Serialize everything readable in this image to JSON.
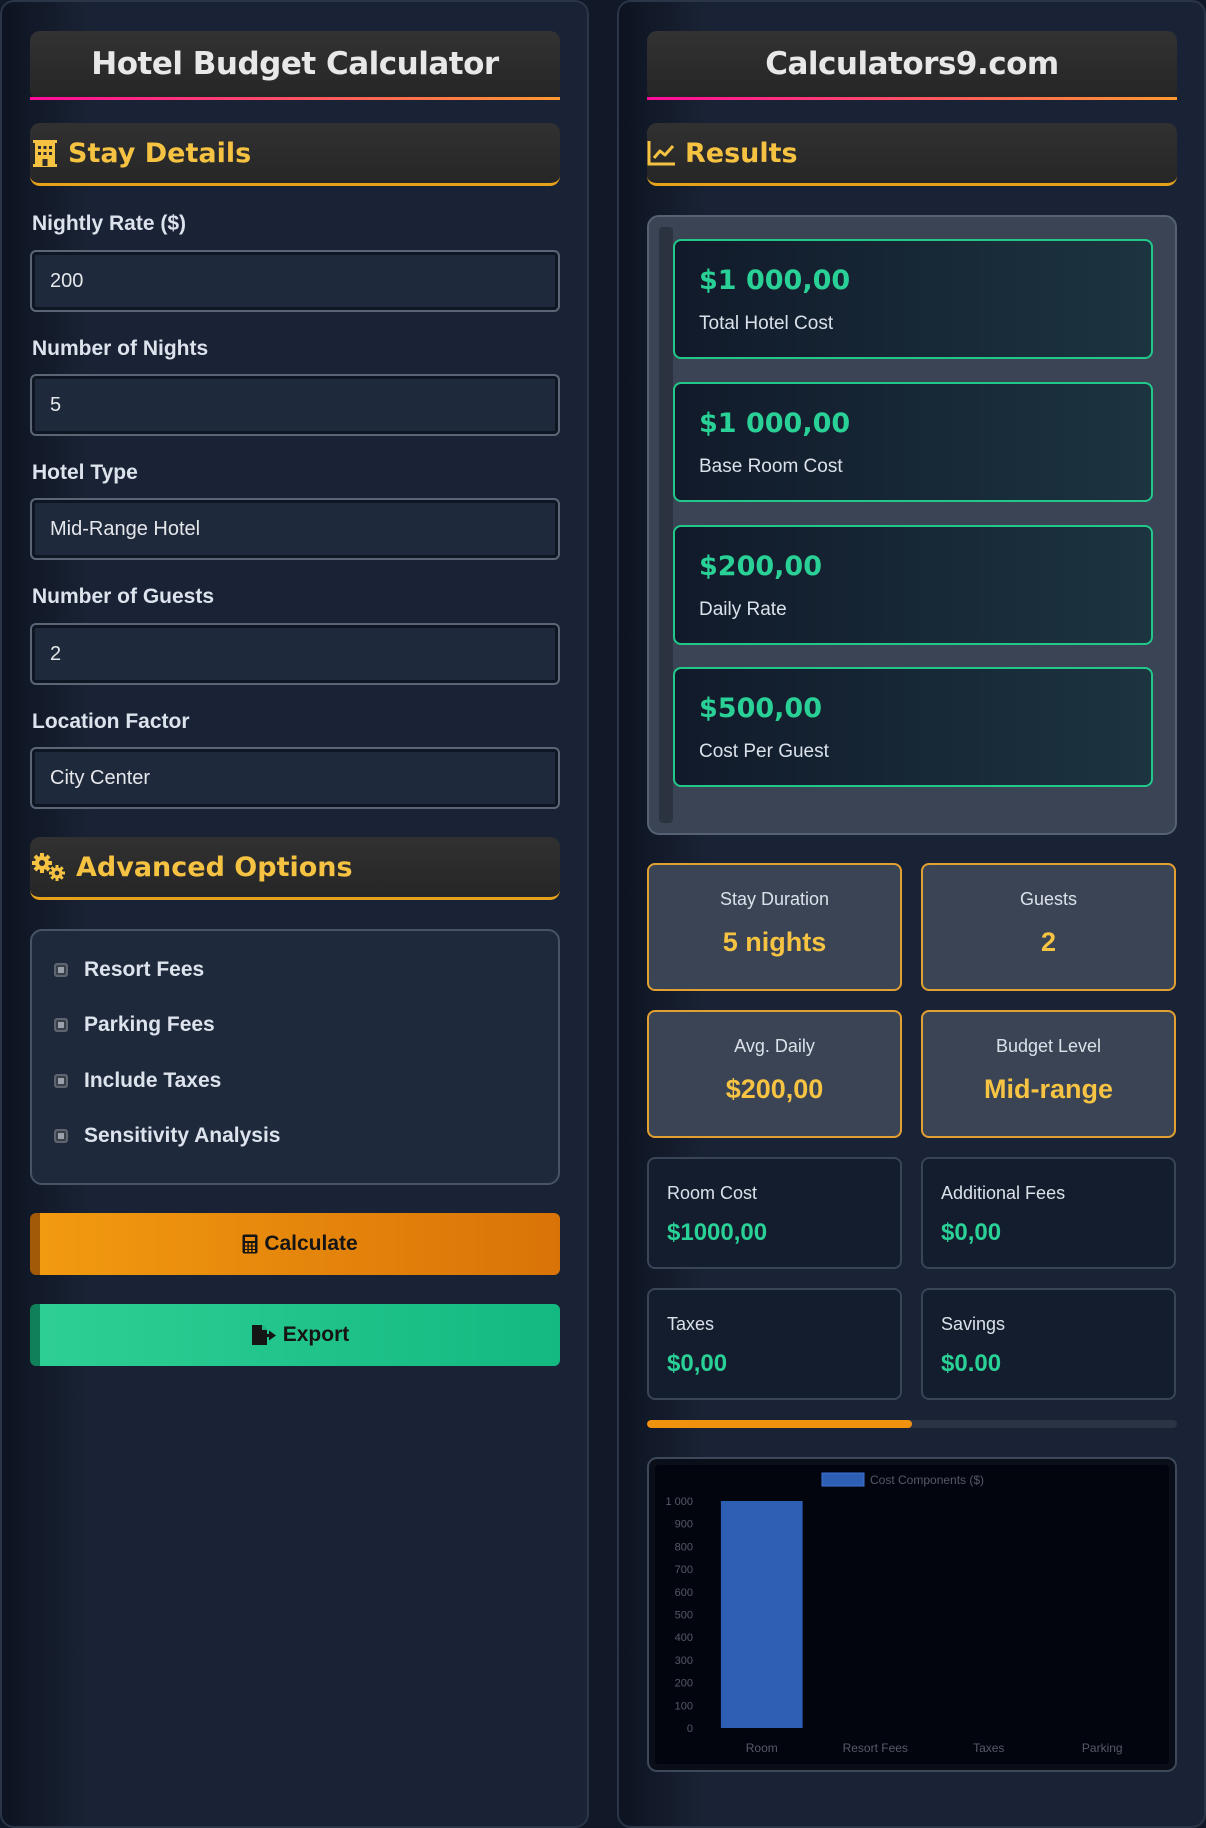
{
  "left": {
    "title": "Hotel Budget Calculator",
    "stay_details": {
      "header": "Stay Details",
      "icon": "hotel-building-icon",
      "fields": [
        {
          "label": "Nightly Rate ($)",
          "value": "200"
        },
        {
          "label": "Number of Nights",
          "value": "5"
        },
        {
          "label": "Hotel Type",
          "value": "Mid-Range Hotel"
        },
        {
          "label": "Number of Guests",
          "value": "2"
        },
        {
          "label": "Location Factor",
          "value": "City Center"
        }
      ]
    },
    "advanced": {
      "header": "Advanced Options",
      "icon": "gears-icon",
      "options": [
        "Resort Fees",
        "Parking Fees",
        "Include Taxes",
        "Sensitivity Analysis"
      ]
    },
    "buttons": {
      "calculate": "Calculate",
      "calculate_icon": "calculator-icon",
      "export": "Export",
      "export_icon": "file-export-icon"
    }
  },
  "right": {
    "title": "Calculators9.com",
    "results": {
      "header": "Results",
      "icon": "chart-line-icon",
      "cards": [
        {
          "value": "$1 000,00",
          "label": "Total Hotel Cost"
        },
        {
          "value": "$1 000,00",
          "label": "Base Room Cost"
        },
        {
          "value": "$200,00",
          "label": "Daily Rate"
        },
        {
          "value": "$500,00",
          "label": "Cost Per Guest"
        }
      ]
    },
    "stats": [
      {
        "label": "Stay Duration",
        "value": "5 nights"
      },
      {
        "label": "Guests",
        "value": "2"
      },
      {
        "label": "Avg. Daily",
        "value": "$200,00"
      },
      {
        "label": "Budget Level",
        "value": "Mid-range"
      }
    ],
    "costs": [
      {
        "label": "Room Cost",
        "value": "$1000,00"
      },
      {
        "label": "Additional Fees",
        "value": "$0,00"
      },
      {
        "label": "Taxes",
        "value": "$0,00"
      },
      {
        "label": "Savings",
        "value": "$0.00"
      }
    ],
    "progress": 0.5
  },
  "colors": {
    "accent_gold": "#f5c242",
    "accent_green": "#2ad196",
    "accent_orange": "#f0920e",
    "bar_blue": "#2d5fb5"
  },
  "chart_data": {
    "type": "bar",
    "categories": [
      "Room",
      "Resort Fees",
      "Taxes",
      "Parking"
    ],
    "series": [
      {
        "name": "Cost Components ($)",
        "values": [
          1000,
          0,
          0,
          0
        ]
      }
    ],
    "yticks": [
      "0",
      "100",
      "200",
      "300",
      "400",
      "500",
      "600",
      "700",
      "800",
      "900",
      "1 000"
    ],
    "ylim": [
      0,
      1000
    ],
    "legend": "top"
  }
}
